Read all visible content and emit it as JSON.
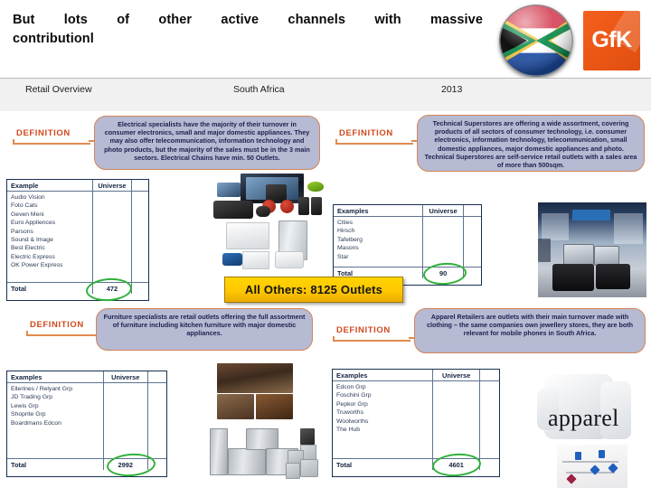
{
  "header": {
    "title_line1": "But lots of other active channels with massive",
    "title_line2": "contributionl",
    "logo_flag_name": "south-africa-flag-sphere",
    "logo_brand_text": "GfK"
  },
  "subbar": {
    "left": "Retail Overview",
    "center": "South Africa",
    "right": "2013"
  },
  "callout": {
    "text": "All Others: 8125 Outlets"
  },
  "definition_label": "DEFINITION",
  "quadrants": [
    {
      "id": "electrical-specialists",
      "definition": "Electrical specialists have the majority of their turnover in consumer electronics, small and major domestic appliances. They may also offer telecommunication, information technology and photo products, but the majority of the sales must be in the 3 main sectors. Electrical Chains have min. 50 Outlets.",
      "table": {
        "col_examples": "Example",
        "col_universe": "Universe",
        "rows": [
          "Audio Vision",
          "Foto Cats",
          "Geven Meni",
          "Euro Appliences",
          "Parsons",
          "Sound & Image",
          "Best Electric",
          "Electric Express",
          "OK Power Express"
        ],
        "total_label": "Total",
        "total_value": "472"
      }
    },
    {
      "id": "technical-superstores",
      "definition": "Technical Superstores are offering a wide assortment, covering products of all sectors of consumer technology, i.e. consumer electronics, information technology, telecommunication, small domestic appliances, major domestic appliances and photo. Technical Superstores are self-service retail outlets with a sales area of more than 500sqm.",
      "table": {
        "col_examples": "Examples",
        "col_universe": "Universe",
        "rows": [
          "Cities",
          "Hirsch",
          "Tafelberg",
          "Masons",
          "Star"
        ],
        "total_label": "Total",
        "total_value": "90"
      }
    },
    {
      "id": "furniture-specialists",
      "definition": "Furniture specialists are retail outlets offering the full assortment of furniture including kitchen furniture with major domestic appliances.",
      "table": {
        "col_examples": "Examples",
        "col_universe": "Universe",
        "rows": [
          "Ellerines / Relyant Grp",
          "JD Trading Grp",
          "Lewis Grp",
          "Shoprite Grp",
          "Boardmans Edcon"
        ],
        "total_label": "Total",
        "total_value": "2992"
      }
    },
    {
      "id": "apparel-retailers",
      "definition": "Apparel Retailers are outlets with their main turnover made with clothing – the same companies own jewellery stores, they are both relevant for mobile phones in South Africa.",
      "table": {
        "col_examples": "Examples",
        "col_universe": "Universe",
        "rows": [
          "Edcon Grp",
          "Foschini Grp",
          "Pepkor Grp",
          "Truworths",
          "Woolworths",
          "The Hub"
        ],
        "total_label": "Total",
        "total_value": "4601"
      }
    }
  ],
  "images": {
    "electronics_collage": "consumer-electronics-collage",
    "technical_store_photo": "technical-superstore-interior-photo",
    "furniture_collage": "furniture-and-appliances-collage",
    "apparel_photo": "apparel-shirt-and-jewellery-photo",
    "apparel_word": "apparel"
  },
  "colors": {
    "definition_label": "#d1491f",
    "definition_box_fill": "#b6bad2",
    "definition_box_border": "#d2855a",
    "table_border": "#16304f",
    "highlight_circle": "#2fb13a",
    "callout_fill": "#ffd400",
    "brand_orange": "#ea5514"
  }
}
